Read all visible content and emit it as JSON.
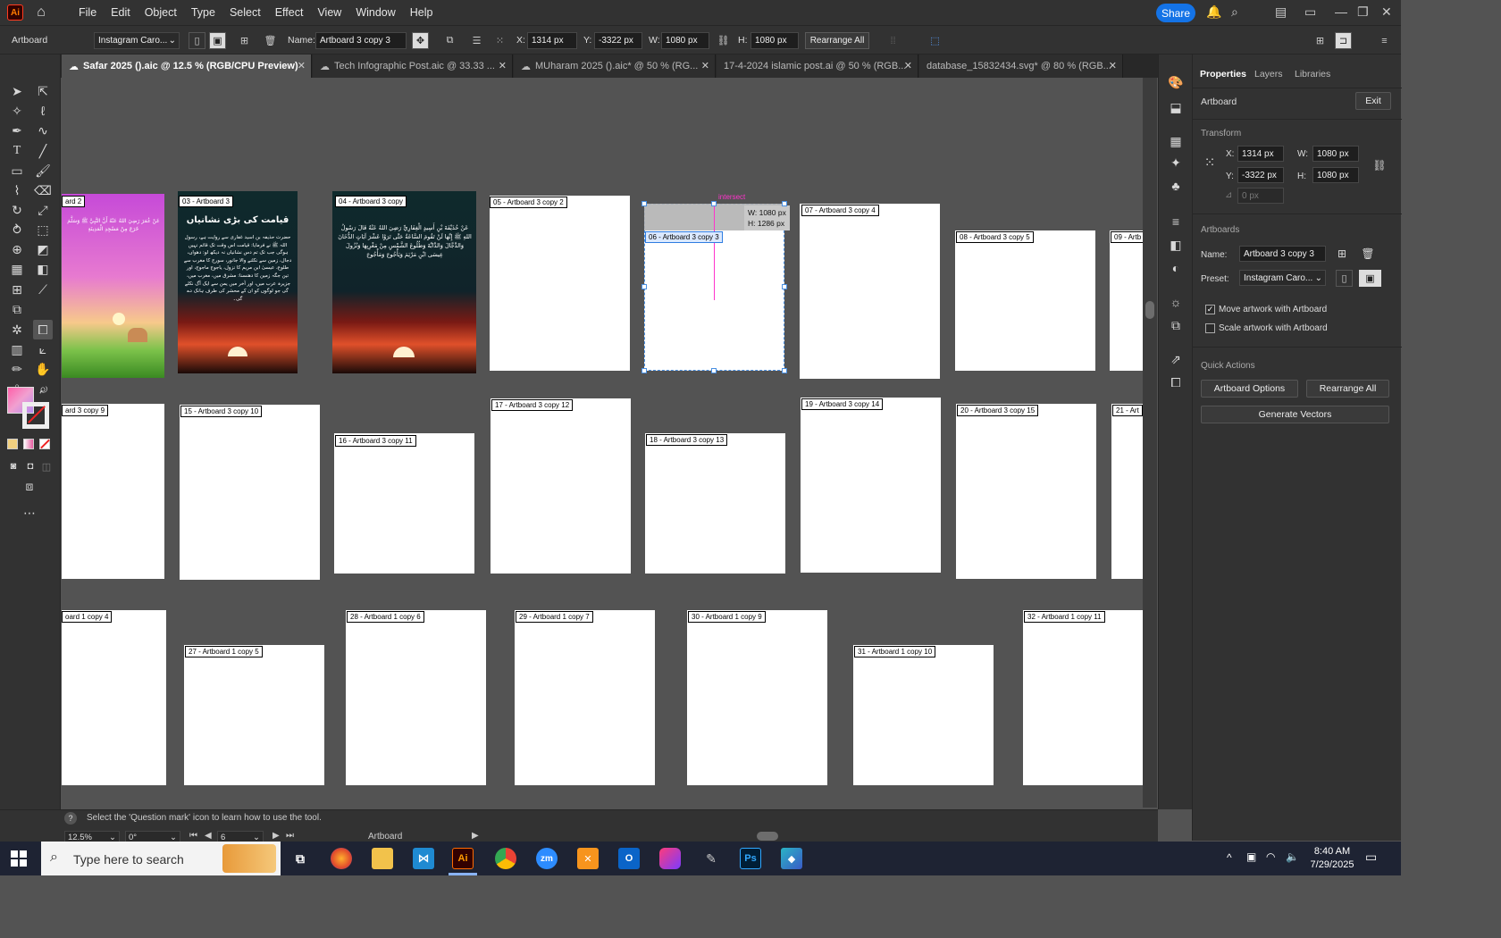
{
  "app": {
    "logo": "Ai",
    "share": "Share"
  },
  "menu": [
    "File",
    "Edit",
    "Object",
    "Type",
    "Select",
    "Effect",
    "View",
    "Window",
    "Help"
  ],
  "control": {
    "artboard_label": "Artboard",
    "preset": "Instagram Caro...",
    "name_label": "Name:",
    "name_value": "Artboard 3 copy 3",
    "x_label": "X:",
    "x_value": "1314 px",
    "y_label": "Y:",
    "y_value": "-3322 px",
    "w_label": "W:",
    "w_value": "1080 px",
    "h_label": "H:",
    "h_value": "1080 px",
    "rearrange": "Rearrange All"
  },
  "tabs": [
    {
      "label": "Safar 2025 ().aic @ 12.5 % (RGB/CPU Preview)"
    },
    {
      "label": "Tech Infographic Post.aic @ 33.33 ..."
    },
    {
      "label": "MUharam 2025 ().aic* @ 50 % (RG..."
    },
    {
      "label": "17-4-2024 islamic post.ai @ 50 % (RGB..."
    },
    {
      "label": "database_15832434.svg* @ 80 % (RGB..."
    }
  ],
  "artboards": [
    {
      "label": "ard 2"
    },
    {
      "label": "03 - Artboard 3"
    },
    {
      "label": "04 - Artboard 3 copy"
    },
    {
      "label": "05 - Artboard 3 copy 2"
    },
    {
      "label": "06 - Artboard 3 copy 3"
    },
    {
      "label": "07 - Artboard 3 copy 4"
    },
    {
      "label": "08 - Artboard 3 copy 5"
    },
    {
      "label": "09 - Artb"
    },
    {
      "label": "ard 3 copy 9"
    },
    {
      "label": "15 - Artboard 3 copy 10"
    },
    {
      "label": "16 - Artboard 3 copy 11"
    },
    {
      "label": "17 - Artboard 3 copy 12"
    },
    {
      "label": "18 - Artboard 3 copy 13"
    },
    {
      "label": "19 - Artboard 3 copy 14"
    },
    {
      "label": "20 - Artboard 3 copy 15"
    },
    {
      "label": "21 - Art"
    },
    {
      "label": "oard 1 copy 4"
    },
    {
      "label": "27 - Artboard 1 copy 5"
    },
    {
      "label": "28 - Artboard 1 copy 6"
    },
    {
      "label": "29 - Artboard 1 copy 7"
    },
    {
      "label": "30 - Artboard 1 copy 9"
    },
    {
      "label": "31 - Artboard 1 copy 10"
    },
    {
      "label": "32 - Artboard 1 copy 11"
    }
  ],
  "smart_guide": {
    "hint": "intersect",
    "w": "W: 1080 px",
    "h": "H: 1286 px"
  },
  "posters": {
    "p1_arabic": "عَنْ عُمَرَ رَضِيَ اللهُ عَنْهُ أَنَّ النَّبِيَّ ﷺ وَسَلَّمَ خَرَجَ مِنْ مَسْجِدِ الْمَدِينَةِ",
    "p2_title": "قیامت کی بڑی نشانیاں",
    "p2_body": "حضرت حذیفہ بن اسید غفاری سے روایت ہے، رسول اللہ ﷺ نے فرمایا: قیامت اس وقت تک قائم نہیں ہوگی جب تک تم دس نشانیاں نہ دیکھ لو: دھواں، دجال، زمین سے نکلنے والا جانور، سورج کا مغرب سے طلوع، عیسیٰ ابن مریم کا نزول، یاجوج ماجوج، اور تین جگہ زمین کا دھنسنا: مشرق میں، مغرب میں، جزیرہ عرب میں، اور آخر میں یمن سے ایک آگ نکلے گی جو لوگوں کو ان کے محشر کی طرف ہانک دے گی۔",
    "p3_arabic": "عَنْ حُذَيْفَةَ بْنِ أَسِيدٍ الْغِفَارِيِّ رَضِيَ اللهُ عَنْهُ قَالَ رَسُولُ اللهِ ﷺ إِنَّهَا لَنْ تَقُومَ السَّاعَةُ حَتَّى تَرَوْا عَشْرَ آيَاتٍ الدُّخَانَ وَالدَّجَّالَ وَالدَّابَّةَ وَطُلُوعَ الشَّمْسِ مِنْ مَغْرِبِهَا وَنُزُولَ عِيسَى ابْنِ مَرْيَمَ وَيَأْجُوجَ وَمَأْجُوجَ"
  },
  "panel": {
    "tabs": [
      "Properties",
      "Layers",
      "Libraries"
    ],
    "section_artboard": "Artboard",
    "exit": "Exit",
    "transform": "Transform",
    "x_label": "X:",
    "x_value": "1314 px",
    "y_label": "Y:",
    "y_value": "-3322 px",
    "w_label": "W:",
    "w_value": "1080 px",
    "h_label": "H:",
    "h_value": "1080 px",
    "angle": "0 px",
    "artboards": "Artboards",
    "name_label": "Name:",
    "name_value": "Artboard 3 copy 3",
    "preset_label": "Preset:",
    "preset_value": "Instagram Caro...",
    "move_artwork": "Move artwork with Artboard",
    "scale_artwork": "Scale artwork with Artboard",
    "quick_actions": "Quick Actions",
    "artboard_options": "Artboard Options",
    "rearrange_all": "Rearrange All",
    "generate_vectors": "Generate Vectors"
  },
  "status": {
    "help_text": "Select the 'Question mark' icon to learn how to use the tool.",
    "zoom": "12.5%",
    "rotate": "0°",
    "page": "6",
    "tool": "Artboard"
  },
  "taskbar": {
    "search_placeholder": "Type here to search",
    "time": "8:40 AM",
    "date": "7/29/2025",
    "apps": [
      "zm",
      "Ai",
      "Ps"
    ]
  },
  "colors": {
    "accent": "#1473e6",
    "adobe_red": "#ff3b1f",
    "selection": "#2f7de1",
    "smart_guide": "#ff33cc"
  }
}
